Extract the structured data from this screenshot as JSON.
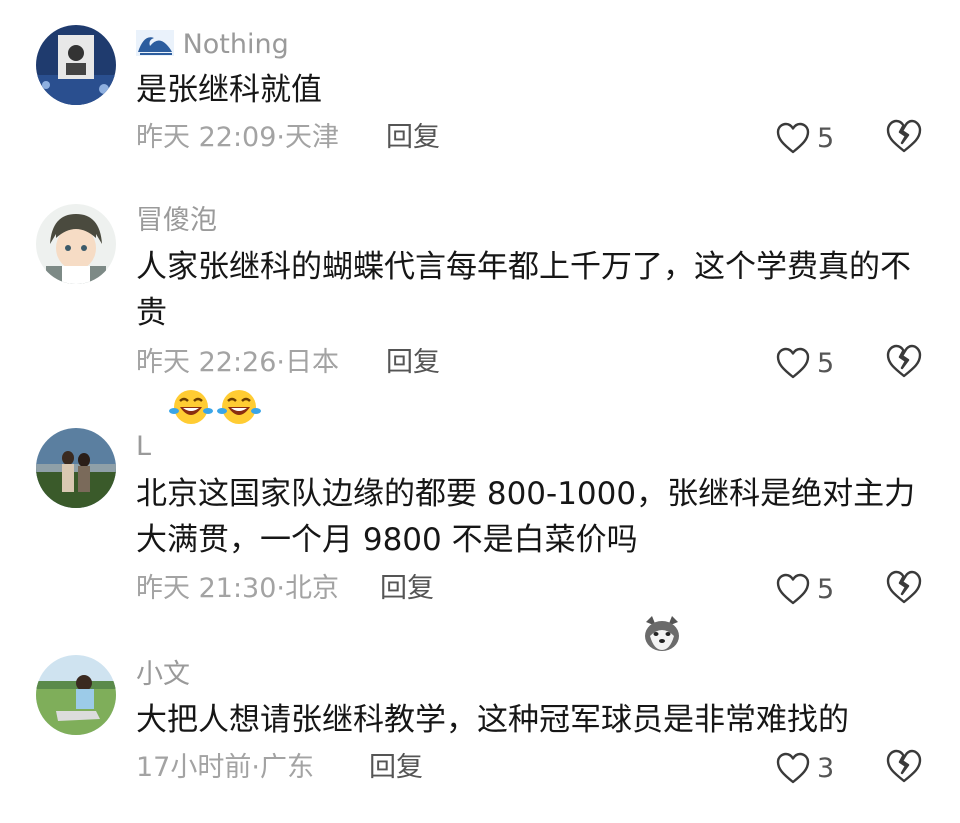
{
  "comments": [
    {
      "username": "Nothing",
      "username_badge": "wave-icon",
      "text": "是张继科就值",
      "time": "昨天 22:09",
      "location": "天津",
      "reply_label": "回复",
      "likes": "5"
    },
    {
      "username": "冒傻泡",
      "text": "人家张继科的蝴蝶代言每年都上千万了，这个学费真的不贵",
      "emojis": [
        "laugh-cry-emoji",
        "laugh-cry-emoji"
      ],
      "time": "昨天 22:26",
      "location": "日本",
      "reply_label": "回复",
      "likes": "5"
    },
    {
      "username": "L",
      "text": "北京这国家队边缘的都要 800-1000，张继科是绝对主力大满贯，一个月 9800 不是白菜价吗",
      "emojis": [
        "husky-emoji"
      ],
      "time": "昨天 21:30",
      "location": "北京",
      "reply_label": "回复",
      "likes": "5"
    },
    {
      "username": "小文",
      "text": "大把人想请张继科教学，这种冠军球员是非常难找的",
      "time": "17小时前",
      "location": "广东",
      "reply_label": "回复",
      "likes": "3"
    }
  ]
}
